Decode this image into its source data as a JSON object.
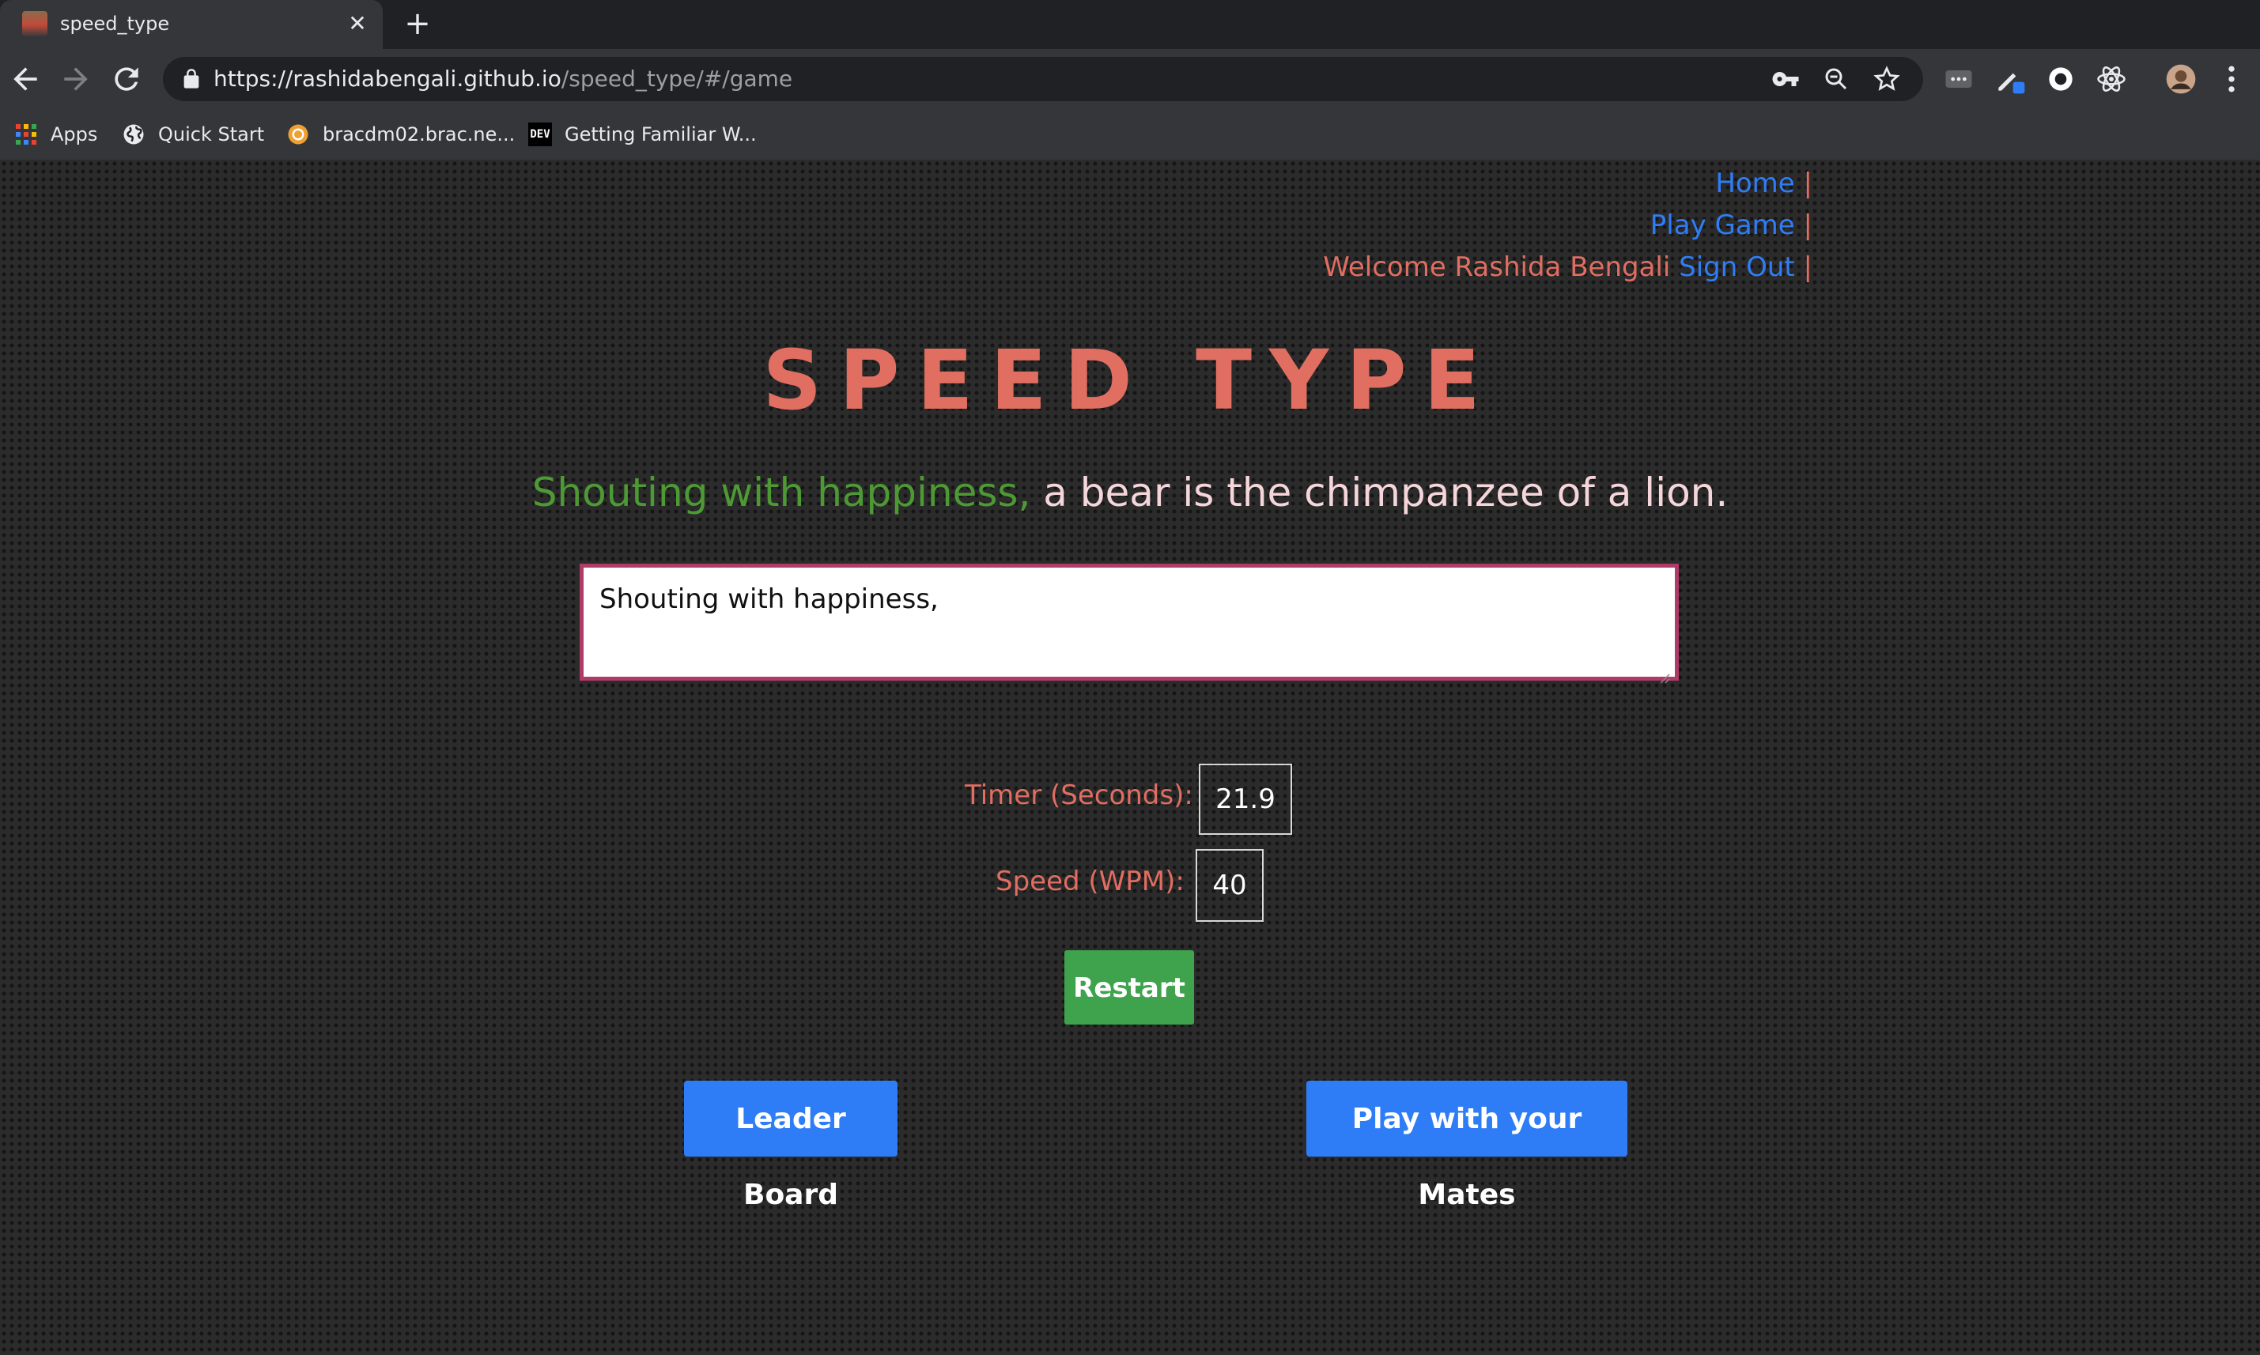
{
  "browser": {
    "tab": {
      "title": "speed_type",
      "close_icon": "close-icon",
      "new_tab_icon": "plus-icon"
    },
    "address_bar": {
      "url_host": "https://rashidabengali.github.io",
      "url_path": "/speed_type/#/game"
    },
    "bookmarks": [
      {
        "label": "Apps",
        "icon": "apps-grid-icon"
      },
      {
        "label": "Quick Start",
        "icon": "globe-icon"
      },
      {
        "label": "bracdm02.brac.ne...",
        "icon": "site-favicon-icon"
      },
      {
        "label": "Getting Familiar W...",
        "icon": "dev-favicon-icon",
        "icon_text": "DEV"
      }
    ]
  },
  "nav": {
    "home": "Home",
    "play_game": "Play Game",
    "welcome": "Welcome Rashida Bengali",
    "sign_out": "Sign Out",
    "separator": "|"
  },
  "game": {
    "title": "SPEED TYPE",
    "prompt_typed": "Shouting with happiness,",
    "prompt_rest": " a bear is the chimpanzee of a lion.",
    "input_value": "Shouting with happiness,",
    "timer_label": "Timer (Seconds):",
    "timer_value": "21.9",
    "speed_label": "Speed (WPM):",
    "speed_value": "40",
    "restart_label": "Restart",
    "leaderboard_label": "Leader Board",
    "mates_label": "Play with your Mates"
  },
  "colors": {
    "accent_red": "#e06e61",
    "link_blue": "#2f7df6",
    "typed_green": "#4d9a34",
    "restart_green": "#3fa34d",
    "input_border": "#b03a68"
  }
}
